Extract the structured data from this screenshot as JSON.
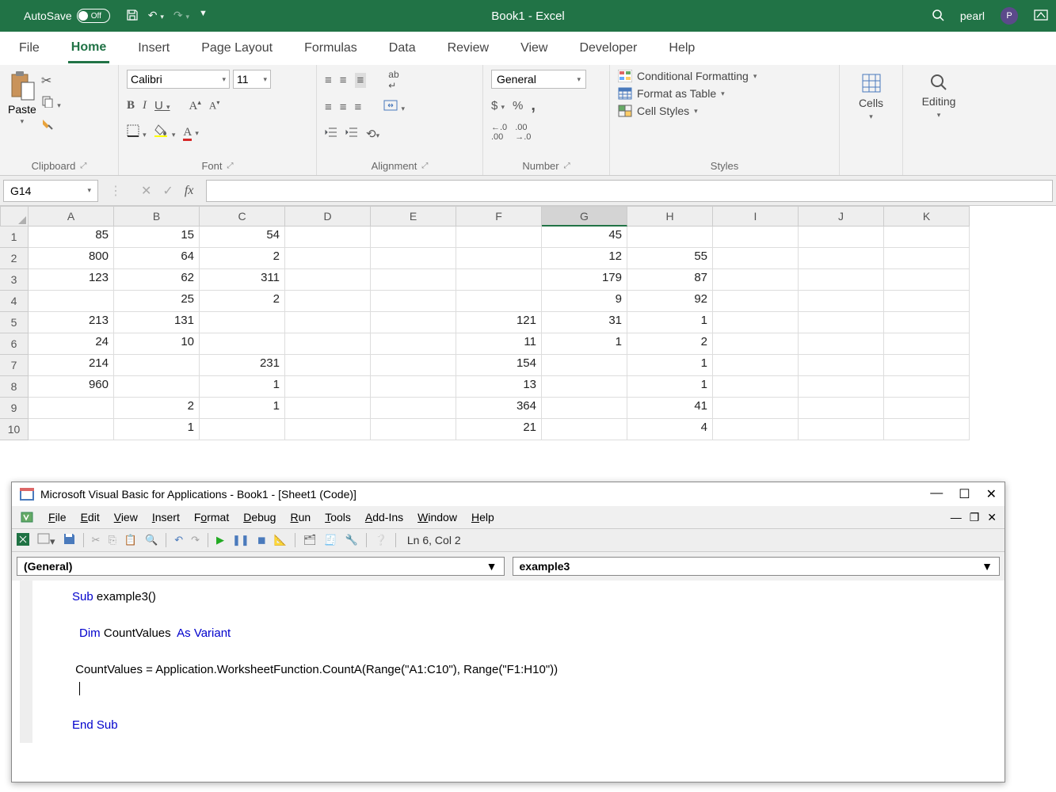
{
  "titlebar": {
    "autosave_label": "AutoSave",
    "autosave_state": "Off",
    "doc_title": "Book1 - Excel",
    "user_name": "pearl",
    "user_initial": "P"
  },
  "ribbon_tabs": [
    "File",
    "Home",
    "Insert",
    "Page Layout",
    "Formulas",
    "Data",
    "Review",
    "View",
    "Developer",
    "Help"
  ],
  "active_tab_index": 1,
  "font": {
    "name": "Calibri",
    "size": "11",
    "group_label": "Font"
  },
  "clipboard": {
    "paste_label": "Paste",
    "group_label": "Clipboard"
  },
  "alignment": {
    "group_label": "Alignment"
  },
  "number": {
    "format": "General",
    "group_label": "Number"
  },
  "styles": {
    "conditional": "Conditional Formatting",
    "table": "Format as Table",
    "cell": "Cell Styles",
    "group_label": "Styles"
  },
  "cells_group": {
    "label": "Cells"
  },
  "editing_group": {
    "label": "Editing"
  },
  "formula_bar": {
    "name_box": "G14",
    "formula": ""
  },
  "columns": [
    "A",
    "B",
    "C",
    "D",
    "E",
    "F",
    "G",
    "H",
    "I",
    "J",
    "K"
  ],
  "active_col_index": 6,
  "rows": [
    1,
    2,
    3,
    4,
    5,
    6,
    7,
    8,
    9,
    10
  ],
  "grid": [
    [
      "85",
      "15",
      "54",
      "",
      "",
      "",
      "45",
      "",
      "",
      "",
      ""
    ],
    [
      "800",
      "64",
      "2",
      "",
      "",
      "",
      "12",
      "55",
      "",
      "",
      ""
    ],
    [
      "123",
      "62",
      "311",
      "",
      "",
      "",
      "179",
      "87",
      "",
      "",
      ""
    ],
    [
      "",
      "25",
      "2",
      "",
      "",
      "",
      "9",
      "92",
      "",
      "",
      ""
    ],
    [
      "213",
      "131",
      "",
      "",
      "",
      "121",
      "31",
      "1",
      "",
      "",
      ""
    ],
    [
      "24",
      "10",
      "",
      "",
      "",
      "11",
      "1",
      "2",
      "",
      "",
      ""
    ],
    [
      "214",
      "",
      "231",
      "",
      "",
      "154",
      "",
      "1",
      "",
      "",
      ""
    ],
    [
      "960",
      "",
      "1",
      "",
      "",
      "13",
      "",
      "1",
      "",
      "",
      ""
    ],
    [
      "",
      "2",
      "1",
      "",
      "",
      "364",
      "",
      "41",
      "",
      "",
      ""
    ],
    [
      "",
      "1",
      "",
      "",
      "",
      "21",
      "",
      "4",
      "",
      "",
      ""
    ]
  ],
  "vba": {
    "title": "Microsoft Visual Basic for Applications - Book1 - [Sheet1 (Code)]",
    "menus": [
      "File",
      "Edit",
      "View",
      "Insert",
      "Format",
      "Debug",
      "Run",
      "Tools",
      "Add-Ins",
      "Window",
      "Help"
    ],
    "cursor_pos": "Ln 6, Col 2",
    "dropdown_left": "(General)",
    "dropdown_right": "example3",
    "code": {
      "l1_kw1": "Sub",
      "l1_name": " example3()",
      "l2_kw1": "Dim",
      "l2_mid": " CountValues  ",
      "l2_kw2": "As Variant",
      "l3": " CountValues = Application.WorksheetFunction.CountA(Range(\"A1:C10\"), Range(\"F1:H10\"))",
      "l4_kw": "End Sub"
    }
  }
}
